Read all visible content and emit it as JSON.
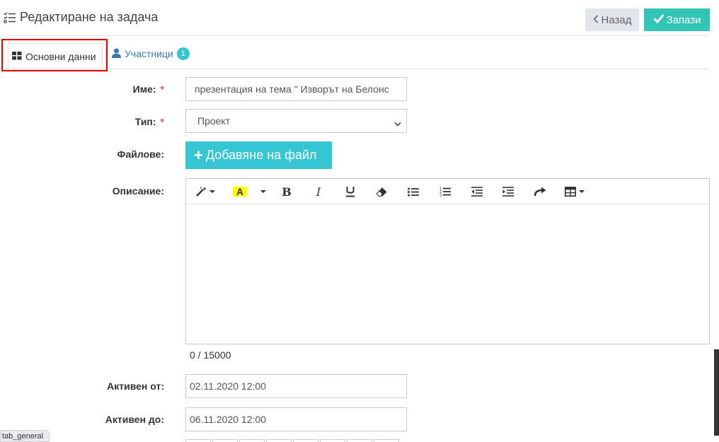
{
  "header": {
    "title": "Редактиране на задача",
    "title_icon": "tasks-list-icon",
    "back_label": "Назад",
    "save_label": "Запази"
  },
  "tabs": [
    {
      "label": "Основни данни",
      "icon": "grid-icon",
      "active": true
    },
    {
      "label": "Участници",
      "icon": "user-icon",
      "badge": "1"
    }
  ],
  "form": {
    "name_label": "Име:",
    "name_value": "презентация на тема \" Изворът на Белонс",
    "type_label": "Тип:",
    "type_value": "Проект",
    "files_label": "Файлове:",
    "add_file_label": "Добавяне на файл",
    "description_label": "Описание:",
    "description_counter": "0 / 15000",
    "active_from_label": "Активен от:",
    "active_from_value": "02.11.2020 12:00",
    "active_to_label": "Активен до:",
    "active_to_value": "06.11.2020 12:00",
    "required_mark": "*"
  },
  "editor_toolbar": {
    "bold": "B",
    "italic": "I",
    "highlight": "A",
    "icons": [
      "magic-wand-icon",
      "highlight-color-icon",
      "bold-icon",
      "italic-icon",
      "underline-icon",
      "eraser-icon",
      "unordered-list-icon",
      "ordered-list-icon",
      "outdent-icon",
      "indent-icon",
      "redo-icon",
      "table-icon"
    ]
  },
  "status_tip": "tab_general",
  "colors": {
    "save": "#32c5b4",
    "back": "#e1e5ec",
    "add_file": "#36c6d3",
    "badge": "#36c6d3",
    "required": "#e7505a",
    "highlight_box": "#e00000",
    "link": "#337ab7"
  }
}
